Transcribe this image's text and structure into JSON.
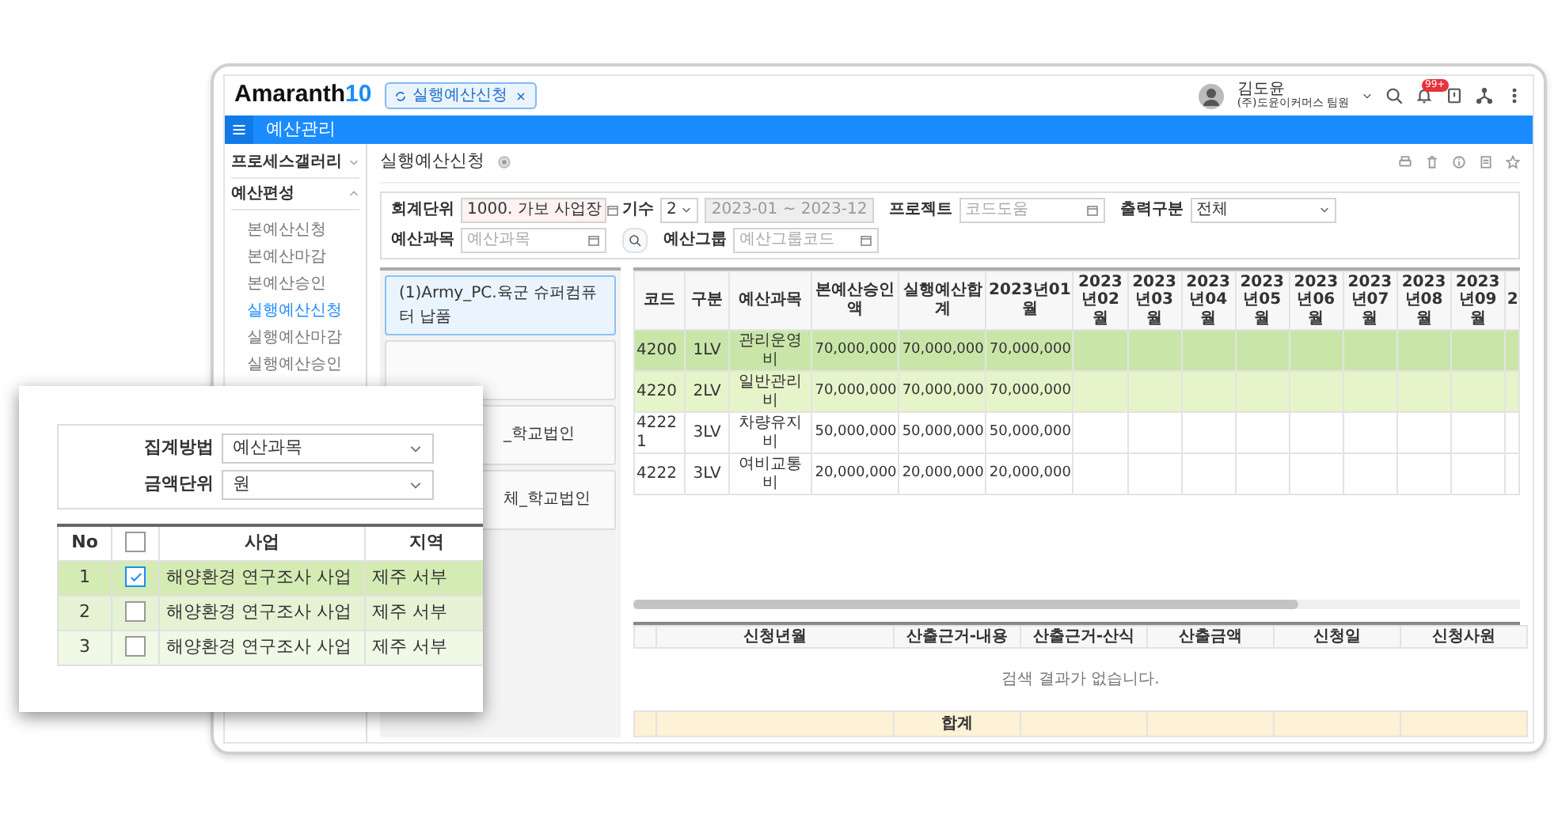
{
  "header": {
    "logo_text": "Amaranth",
    "logo_version": "10",
    "open_tab": {
      "label": "실행예산신청",
      "selected": true
    },
    "user": {
      "name": "김도윤",
      "org": "(주)도윤이커머스 팀원"
    },
    "notification_badge": "99+"
  },
  "menu_bar": {
    "title": "예산관리"
  },
  "sidebar": {
    "groups": [
      {
        "label": "프로세스갤러리",
        "expanded": false
      },
      {
        "label": "예산편성",
        "expanded": true,
        "children": [
          {
            "label": "본예산신청",
            "selected": false
          },
          {
            "label": "본예산마감",
            "selected": false
          },
          {
            "label": "본예산승인",
            "selected": false
          },
          {
            "label": "실행예산신청",
            "selected": true
          },
          {
            "label": "실행예산마감",
            "selected": false
          },
          {
            "label": "실행예산승인",
            "selected": false
          }
        ]
      }
    ]
  },
  "page": {
    "title": "실행예산신청"
  },
  "filters": [
    {
      "kind": "picker",
      "label": "회계단위",
      "value": "1000. 가보 사업장",
      "required": true
    },
    {
      "kind": "term",
      "label": "기수",
      "value": "2",
      "range": "2023-01 ~ 2023-12",
      "required": false
    },
    {
      "kind": "picker",
      "label": "프로젝트",
      "placeholder": "코드도움",
      "required": false
    },
    {
      "kind": "select",
      "label": "출력구분",
      "value": "전체",
      "required": false
    },
    {
      "kind": "picker",
      "label": "예산과목",
      "placeholder": "예산과목",
      "required": false
    },
    {
      "kind": "picker",
      "label": "예산그룹",
      "placeholder": "예산그룹코드",
      "required": false
    }
  ],
  "projects": [
    {
      "label": "(1)Army_PC.육군 슈퍼컴퓨터 납품",
      "selected": true
    },
    {
      "selected": false
    },
    {
      "label": "_학교법인",
      "selected": false
    },
    {
      "label": "체_학교법인",
      "selected": false
    }
  ],
  "grid": {
    "columns": [
      "코드",
      "구분",
      "예산과목",
      "본예산승인액",
      "실행예산합계",
      "2023년01월",
      "2023년02월",
      "2023년03월",
      "2023년04월",
      "2023년05월",
      "2023년06월",
      "2023년07월",
      "2023년08월",
      "2023년09월",
      "2"
    ],
    "rows": [
      {
        "color": "#c9e6a8",
        "cells": [
          "4200",
          "1LV",
          "관리운영비",
          "70,000,000",
          "70,000,000",
          "70,000,000"
        ]
      },
      {
        "color": "#e6f4c9",
        "cells": [
          "4220",
          "2LV",
          "일반관리비",
          "70,000,000",
          "70,000,000",
          "70,000,000"
        ]
      },
      {
        "color": "#ffffff",
        "cells": [
          "42221",
          "3LV",
          "차량유지비",
          "50,000,000",
          "50,000,000",
          "50,000,000"
        ]
      },
      {
        "color": "#ffffff",
        "cells": [
          "4222",
          "3LV",
          "여비교통비",
          "20,000,000",
          "20,000,000",
          "20,000,000"
        ]
      }
    ]
  },
  "detail_table": {
    "columns": [
      "신청년월",
      "산출근거-내용",
      "산출근거-산식",
      "산출금액",
      "신청일",
      "신청사원"
    ],
    "empty_message": "검색 결과가 없습니다.",
    "total_label": "합계"
  },
  "zoom_panel": {
    "options": [
      {
        "label": "집계방법",
        "value": "예산과목"
      },
      {
        "label": "금액단위",
        "value": "원"
      }
    ],
    "columns": [
      "No",
      "사업",
      "지역"
    ],
    "header_checked": false,
    "rows": [
      {
        "no": "1",
        "checked": true,
        "color": "#d5ebb4",
        "business": "해양환경 연구조사 사업",
        "region": "제주 서부"
      },
      {
        "no": "2",
        "checked": false,
        "color": "#e6f2d4",
        "business": "해양환경 연구조사 사업",
        "region": "제주 서부"
      },
      {
        "no": "3",
        "checked": false,
        "color": "#f0f8e6",
        "business": "해양환경 연구조사 사업",
        "region": "제주 서부"
      }
    ]
  }
}
